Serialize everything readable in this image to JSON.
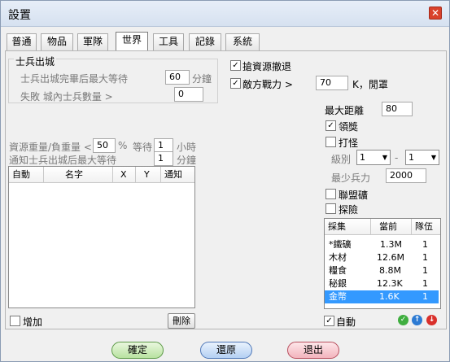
{
  "window": {
    "title": "設置",
    "close_glyph": "✕"
  },
  "tabs": [
    {
      "label": "普通"
    },
    {
      "label": "物品"
    },
    {
      "label": "軍隊"
    },
    {
      "label": "世界"
    },
    {
      "label": "工具"
    },
    {
      "label": "記錄"
    },
    {
      "label": "系統"
    }
  ],
  "soldier": {
    "group_title": "士兵出城",
    "wait_label": "士兵出城完畢后最大等待",
    "wait_value": "60",
    "wait_unit": "分鐘",
    "fail_label": "失敗 城內士兵數量 >",
    "fail_value": "0"
  },
  "retreat": {
    "label": "搶資源撤退",
    "checked": true
  },
  "enemy_power": {
    "label": "敵方戰力 >",
    "value": "70",
    "unit": "K，閒罩",
    "checked": true
  },
  "max_distance": {
    "label": "最大距離",
    "value": "80"
  },
  "reward": {
    "label": "領獎",
    "checked": true
  },
  "monster": {
    "label": "打怪",
    "checked": false,
    "level_label": "級別",
    "level_from": "1",
    "dash": "-",
    "level_to": "1",
    "min_troops_label": "最少兵力",
    "min_troops_value": "2000"
  },
  "alliance_mine": {
    "label": "聯盟礦",
    "checked": false
  },
  "explore": {
    "label": "探險",
    "checked": false
  },
  "resource": {
    "ratio_label": "資源重量/負重量 <",
    "ratio_value": "50",
    "ratio_unit": "%",
    "wait_label": "等待",
    "wait_value": "1",
    "wait_unit": "小時",
    "notify_label": "通知士兵出城后最大等待",
    "notify_value": "1",
    "notify_unit": "分鐘"
  },
  "left_table": {
    "headers": [
      "自動",
      "名字",
      "X",
      "Y",
      "通知"
    ]
  },
  "add": {
    "label": "增加",
    "checked": false
  },
  "delete_label": "刪除",
  "gather": {
    "headers": [
      "採集",
      "當前",
      "隊伍"
    ],
    "rows": [
      {
        "name": "*鐵礦",
        "current": "1.3M",
        "team": "1"
      },
      {
        "name": "木材",
        "current": "12.6M",
        "team": "1"
      },
      {
        "name": "糧食",
        "current": "8.8M",
        "team": "1"
      },
      {
        "name": "秘銀",
        "current": "12.3K",
        "team": "1"
      },
      {
        "name": "金幣",
        "current": "1.6K",
        "team": "1",
        "selected": true
      }
    ]
  },
  "auto": {
    "label": "自動",
    "checked": true
  },
  "icons": {
    "ok": "✓",
    "up": "↑",
    "down": "↓"
  },
  "buttons": {
    "confirm": "確定",
    "restore": "還原",
    "exit": "退出"
  }
}
